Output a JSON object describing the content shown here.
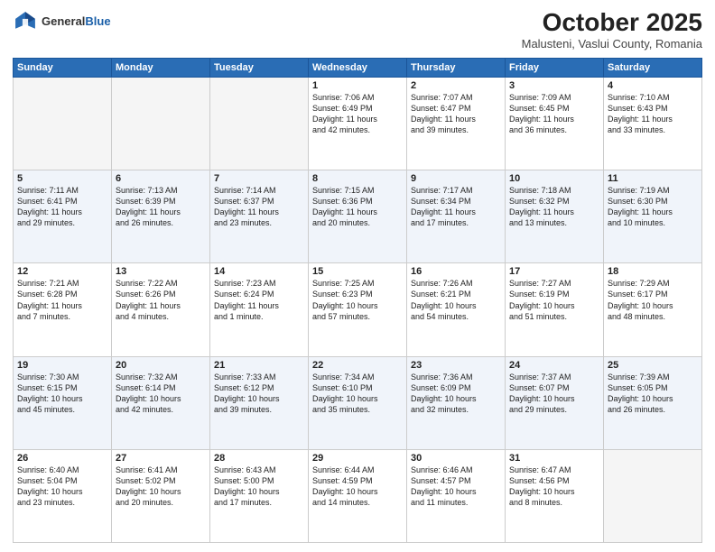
{
  "header": {
    "logo_general": "General",
    "logo_blue": "Blue",
    "title": "October 2025",
    "subtitle": "Malusteni, Vaslui County, Romania"
  },
  "weekdays": [
    "Sunday",
    "Monday",
    "Tuesday",
    "Wednesday",
    "Thursday",
    "Friday",
    "Saturday"
  ],
  "weeks": [
    [
      {
        "day": "",
        "info": ""
      },
      {
        "day": "",
        "info": ""
      },
      {
        "day": "",
        "info": ""
      },
      {
        "day": "1",
        "info": "Sunrise: 7:06 AM\nSunset: 6:49 PM\nDaylight: 11 hours\nand 42 minutes."
      },
      {
        "day": "2",
        "info": "Sunrise: 7:07 AM\nSunset: 6:47 PM\nDaylight: 11 hours\nand 39 minutes."
      },
      {
        "day": "3",
        "info": "Sunrise: 7:09 AM\nSunset: 6:45 PM\nDaylight: 11 hours\nand 36 minutes."
      },
      {
        "day": "4",
        "info": "Sunrise: 7:10 AM\nSunset: 6:43 PM\nDaylight: 11 hours\nand 33 minutes."
      }
    ],
    [
      {
        "day": "5",
        "info": "Sunrise: 7:11 AM\nSunset: 6:41 PM\nDaylight: 11 hours\nand 29 minutes."
      },
      {
        "day": "6",
        "info": "Sunrise: 7:13 AM\nSunset: 6:39 PM\nDaylight: 11 hours\nand 26 minutes."
      },
      {
        "day": "7",
        "info": "Sunrise: 7:14 AM\nSunset: 6:37 PM\nDaylight: 11 hours\nand 23 minutes."
      },
      {
        "day": "8",
        "info": "Sunrise: 7:15 AM\nSunset: 6:36 PM\nDaylight: 11 hours\nand 20 minutes."
      },
      {
        "day": "9",
        "info": "Sunrise: 7:17 AM\nSunset: 6:34 PM\nDaylight: 11 hours\nand 17 minutes."
      },
      {
        "day": "10",
        "info": "Sunrise: 7:18 AM\nSunset: 6:32 PM\nDaylight: 11 hours\nand 13 minutes."
      },
      {
        "day": "11",
        "info": "Sunrise: 7:19 AM\nSunset: 6:30 PM\nDaylight: 11 hours\nand 10 minutes."
      }
    ],
    [
      {
        "day": "12",
        "info": "Sunrise: 7:21 AM\nSunset: 6:28 PM\nDaylight: 11 hours\nand 7 minutes."
      },
      {
        "day": "13",
        "info": "Sunrise: 7:22 AM\nSunset: 6:26 PM\nDaylight: 11 hours\nand 4 minutes."
      },
      {
        "day": "14",
        "info": "Sunrise: 7:23 AM\nSunset: 6:24 PM\nDaylight: 11 hours\nand 1 minute."
      },
      {
        "day": "15",
        "info": "Sunrise: 7:25 AM\nSunset: 6:23 PM\nDaylight: 10 hours\nand 57 minutes."
      },
      {
        "day": "16",
        "info": "Sunrise: 7:26 AM\nSunset: 6:21 PM\nDaylight: 10 hours\nand 54 minutes."
      },
      {
        "day": "17",
        "info": "Sunrise: 7:27 AM\nSunset: 6:19 PM\nDaylight: 10 hours\nand 51 minutes."
      },
      {
        "day": "18",
        "info": "Sunrise: 7:29 AM\nSunset: 6:17 PM\nDaylight: 10 hours\nand 48 minutes."
      }
    ],
    [
      {
        "day": "19",
        "info": "Sunrise: 7:30 AM\nSunset: 6:15 PM\nDaylight: 10 hours\nand 45 minutes."
      },
      {
        "day": "20",
        "info": "Sunrise: 7:32 AM\nSunset: 6:14 PM\nDaylight: 10 hours\nand 42 minutes."
      },
      {
        "day": "21",
        "info": "Sunrise: 7:33 AM\nSunset: 6:12 PM\nDaylight: 10 hours\nand 39 minutes."
      },
      {
        "day": "22",
        "info": "Sunrise: 7:34 AM\nSunset: 6:10 PM\nDaylight: 10 hours\nand 35 minutes."
      },
      {
        "day": "23",
        "info": "Sunrise: 7:36 AM\nSunset: 6:09 PM\nDaylight: 10 hours\nand 32 minutes."
      },
      {
        "day": "24",
        "info": "Sunrise: 7:37 AM\nSunset: 6:07 PM\nDaylight: 10 hours\nand 29 minutes."
      },
      {
        "day": "25",
        "info": "Sunrise: 7:39 AM\nSunset: 6:05 PM\nDaylight: 10 hours\nand 26 minutes."
      }
    ],
    [
      {
        "day": "26",
        "info": "Sunrise: 6:40 AM\nSunset: 5:04 PM\nDaylight: 10 hours\nand 23 minutes."
      },
      {
        "day": "27",
        "info": "Sunrise: 6:41 AM\nSunset: 5:02 PM\nDaylight: 10 hours\nand 20 minutes."
      },
      {
        "day": "28",
        "info": "Sunrise: 6:43 AM\nSunset: 5:00 PM\nDaylight: 10 hours\nand 17 minutes."
      },
      {
        "day": "29",
        "info": "Sunrise: 6:44 AM\nSunset: 4:59 PM\nDaylight: 10 hours\nand 14 minutes."
      },
      {
        "day": "30",
        "info": "Sunrise: 6:46 AM\nSunset: 4:57 PM\nDaylight: 10 hours\nand 11 minutes."
      },
      {
        "day": "31",
        "info": "Sunrise: 6:47 AM\nSunset: 4:56 PM\nDaylight: 10 hours\nand 8 minutes."
      },
      {
        "day": "",
        "info": ""
      }
    ]
  ]
}
